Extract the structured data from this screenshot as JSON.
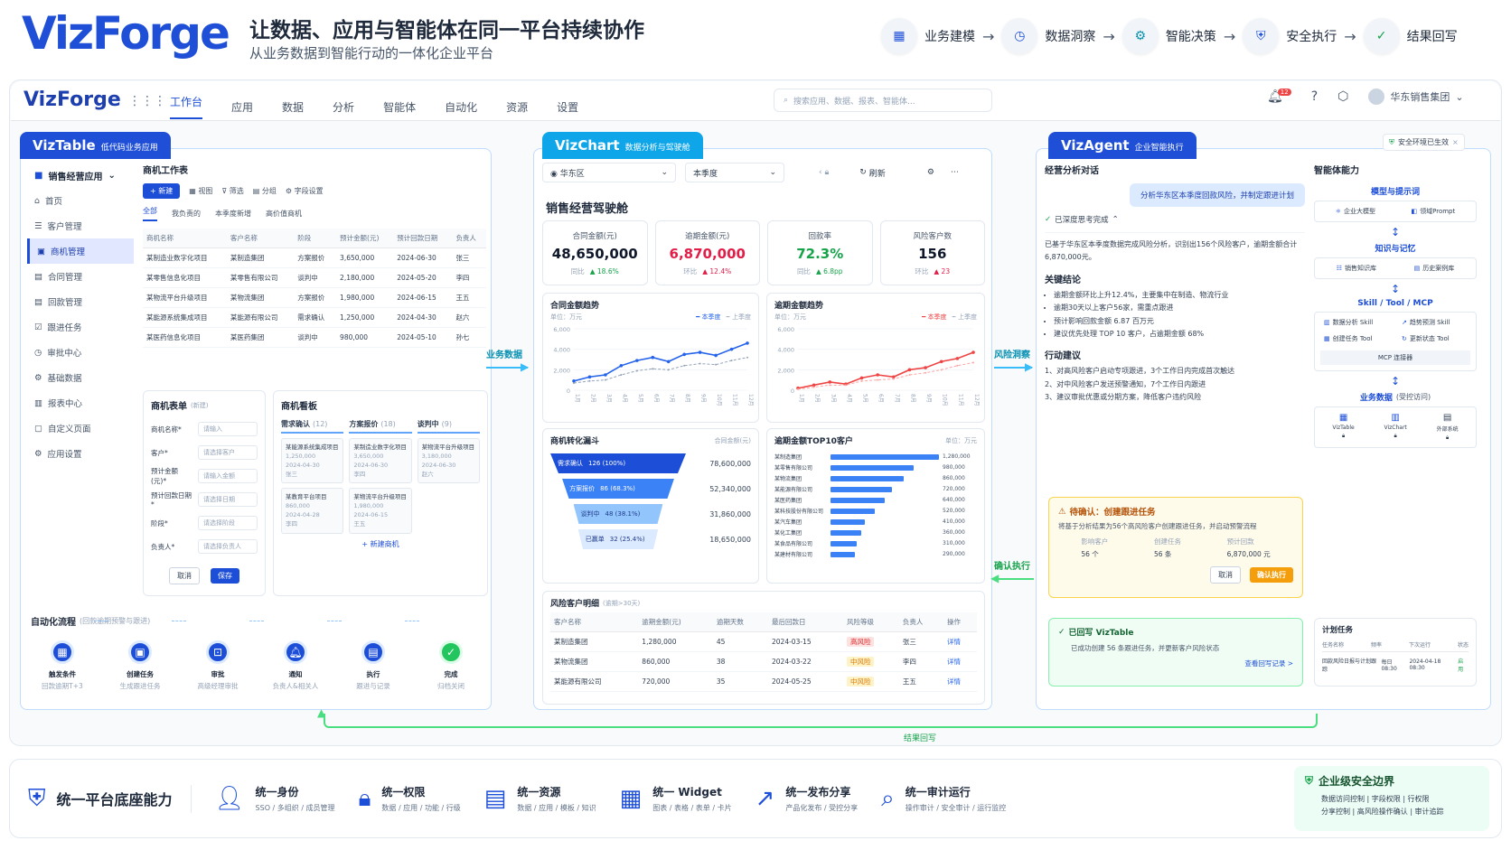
{
  "header": {
    "brand": "VizForge",
    "tagline": "让数据、应用与智能体在同一平台持续协作",
    "subline": "从业务数据到智能行动的一体化企业平台",
    "flow": [
      "业务建模",
      "数据洞察",
      "智能决策",
      "安全执行",
      "结果回写"
    ]
  },
  "nav": {
    "logo": "VizForge",
    "tabs": [
      "工作台",
      "应用",
      "数据",
      "分析",
      "智能体",
      "自动化",
      "资源",
      "设置"
    ],
    "search_placeholder": "搜索应用、数据、报表、智能体...",
    "notif_count": "12",
    "org": "华东销售集团"
  },
  "viztable": {
    "tab_title": "VizTable",
    "tab_sub": "低代码业务应用",
    "app_name": "销售经营应用",
    "side": [
      "首页",
      "客户管理",
      "商机管理",
      "合同管理",
      "回款管理",
      "跟进任务",
      "审批中心",
      "基础数据",
      "报表中心",
      "自定义页面",
      "应用设置"
    ],
    "work_title": "商机工作表",
    "toolbar": {
      "new": "+ 新建",
      "view": "视图",
      "filter": "筛选",
      "group": "分组",
      "field": "字段设置"
    },
    "subtabs": [
      "全部",
      "我负责的",
      "本季度新增",
      "高价值商机"
    ],
    "table_headers": [
      "商机名称",
      "客户名称",
      "阶段",
      "预计金额(元)",
      "预计回款日期",
      "负责人"
    ],
    "table_rows": [
      [
        "某制造业数字化项目",
        "某制造集团",
        "方案报价",
        "3,650,000",
        "2024-06-30",
        "张三"
      ],
      [
        "某零售信息化项目",
        "某零售有限公司",
        "谈判中",
        "2,180,000",
        "2024-05-20",
        "李四"
      ],
      [
        "某物流平台升级项目",
        "某物流集团",
        "方案报价",
        "1,980,000",
        "2024-06-15",
        "王五"
      ],
      [
        "某能源系统集成项目",
        "某能源有限公司",
        "需求确认",
        "1,250,000",
        "2024-04-30",
        "赵六"
      ],
      [
        "某医药信息化项目",
        "某医药集团",
        "谈判中",
        "980,000",
        "2024-05-10",
        "孙七"
      ]
    ],
    "form": {
      "title": "商机表单",
      "title_tag": "(新建)",
      "fields": [
        {
          "label": "商机名称*",
          "ph": "请输入"
        },
        {
          "label": "客户*",
          "ph": "请选择客户"
        },
        {
          "label": "预计金额(元)*",
          "ph": "请输入金额"
        },
        {
          "label": "预计回款日期*",
          "ph": "请选择日期"
        },
        {
          "label": "阶段*",
          "ph": "请选择阶段"
        },
        {
          "label": "负责人*",
          "ph": "请选择负责人"
        }
      ],
      "cancel": "取消",
      "save": "保存"
    },
    "kanban": {
      "title": "商机看板",
      "cols": [
        {
          "head": "需求确认",
          "count": "(12)",
          "cards": [
            {
              "l1": "某能源系统集成项目",
              "l2": "1,250,000",
              "l3": "2024-04-30",
              "l4": "张三"
            },
            {
              "l1": "某教育平台项目",
              "l2": "860,000",
              "l3": "2024-04-28",
              "l4": "李四"
            }
          ]
        },
        {
          "head": "方案报价",
          "count": "(18)",
          "cards": [
            {
              "l1": "某制造业数字化项目",
              "l2": "3,650,000",
              "l3": "2024-06-30",
              "l4": "李四"
            },
            {
              "l1": "某物流平台升级项目",
              "l2": "1,980,000",
              "l3": "2024-06-15",
              "l4": "王五"
            }
          ]
        },
        {
          "head": "谈判中",
          "count": "(9)",
          "cards": [
            {
              "l1": "某物流平台升级项目",
              "l2": "3,180,000",
              "l3": "2024-06-30",
              "l4": "赵六"
            }
          ]
        }
      ],
      "add": "+ 新建商机"
    },
    "auto": {
      "title": "自动化流程",
      "sub": "(回款逾期预警与跟进)",
      "steps": [
        {
          "t": "触发条件",
          "d": "回款逾期T+3"
        },
        {
          "t": "创建任务",
          "d": "生成跟进任务"
        },
        {
          "t": "审批",
          "d": "高级经理审批"
        },
        {
          "t": "通知",
          "d": "负责人&相关人"
        },
        {
          "t": "执行",
          "d": "跟进与记录"
        },
        {
          "t": "完成",
          "d": "归档关闭"
        }
      ]
    }
  },
  "vizchart": {
    "tab_title": "VizChart",
    "tab_sub": "数据分析与驾驶舱",
    "region": "华东区",
    "period": "本季度",
    "refresh": "刷新",
    "title": "销售经营驾驶舱",
    "kpis": [
      {
        "label": "合同金额(元)",
        "value": "48,650,000",
        "chg_lbl": "同比",
        "chg": "18.6%",
        "color": "#0f172a",
        "chg_color": "#16a34a"
      },
      {
        "label": "逾期金额(元)",
        "value": "6,870,000",
        "chg_lbl": "环比",
        "chg": "12.4%",
        "color": "#e11d48",
        "chg_color": "#e11d48"
      },
      {
        "label": "回款率",
        "value": "72.3%",
        "chg_lbl": "同比",
        "chg": "6.8pp",
        "color": "#16a34a",
        "chg_color": "#16a34a"
      },
      {
        "label": "风险客户数",
        "value": "156",
        "chg_lbl": "环比",
        "chg": "23",
        "color": "#0f172a",
        "chg_color": "#e11d48"
      }
    ],
    "trend1": {
      "title": "合同金额趋势",
      "unit": "单位：万元",
      "legend": [
        "本季度",
        "上季度"
      ]
    },
    "trend2": {
      "title": "逾期金额趋势",
      "unit": "单位：万元",
      "legend": [
        "本季度",
        "上季度"
      ]
    },
    "funnel": {
      "title": "商机转化漏斗",
      "unit": "合同金额(元)",
      "stages": [
        {
          "name": "需求确认",
          "cnt": "126 (100%)",
          "amount": "78,600,000",
          "color": "#1d4ed8",
          "frac": 1.0
        },
        {
          "name": "方案报价",
          "cnt": "86 (68.3%)",
          "amount": "52,340,000",
          "color": "#3b82f6",
          "frac": 0.683
        },
        {
          "name": "谈判中",
          "cnt": "48 (38.1%)",
          "amount": "31,860,000",
          "color": "#93c5fd",
          "frac": 0.381
        },
        {
          "name": "已赢单",
          "cnt": "32 (25.4%)",
          "amount": "18,650,000",
          "color": "#dbeafe",
          "frac": 0.254
        }
      ]
    },
    "top10": {
      "title": "逾期金额TOP10客户",
      "unit": "单位：万元",
      "names": [
        "某制造集团",
        "某零售有限公司",
        "某物流集团",
        "某能源有限公司",
        "某医药集团",
        "某科技股份有限公司",
        "某汽车集团",
        "某化工集团",
        "某食品有限公司",
        "某建材有限公司"
      ],
      "values": [
        "1,280,000",
        "980,000",
        "860,000",
        "720,000",
        "640,000",
        "520,000",
        "410,000",
        "360,000",
        "310,000",
        "290,000"
      ]
    },
    "risk": {
      "title": "风险客户明细",
      "sub": "(逾期>30天)",
      "headers": [
        "客户名称",
        "逾期金额(元)",
        "逾期天数",
        "最后回款日",
        "风险等级",
        "负责人",
        "操作"
      ],
      "rows": [
        [
          "某制造集团",
          "1,280,000",
          "45",
          "2024-03-15",
          "高风险",
          "张三",
          "详情"
        ],
        [
          "某物流集团",
          "860,000",
          "38",
          "2024-03-22",
          "中风险",
          "李四",
          "详情"
        ],
        [
          "某能源有限公司",
          "720,000",
          "35",
          "2024-05-25",
          "中风险",
          "王五",
          "详情"
        ]
      ]
    }
  },
  "chart_data": [
    {
      "type": "line",
      "title": "合同金额趋势",
      "ylabel": "单位：万元",
      "ylim": [
        0,
        6000
      ],
      "yticks": [
        "6,000",
        "4,000",
        "2,000",
        "0"
      ],
      "x": [
        "1月",
        "2月",
        "3月",
        "4月",
        "5月",
        "6月",
        "7月",
        "8月",
        "9月",
        "10月",
        "11月",
        "12月"
      ],
      "series": [
        {
          "name": "本季度",
          "color": "#2563eb",
          "values": [
            900,
            1300,
            1500,
            2400,
            2900,
            3200,
            2800,
            3500,
            3700,
            3400,
            4000,
            4600
          ]
        },
        {
          "name": "上季度",
          "color": "#94a3b8",
          "values": [
            700,
            900,
            1000,
            1500,
            1900,
            2100,
            2000,
            2400,
            2600,
            2500,
            2900,
            3200
          ]
        }
      ]
    },
    {
      "type": "line",
      "title": "逾期金额趋势",
      "ylabel": "单位：万元",
      "ylim": [
        0,
        6000
      ],
      "yticks": [
        "6,000",
        "4,000",
        "2,000",
        "0"
      ],
      "x": [
        "1月",
        "2月",
        "3月",
        "4月",
        "5月",
        "6月",
        "7月",
        "8月",
        "9月",
        "10月",
        "11月",
        "12月"
      ],
      "series": [
        {
          "name": "本季度",
          "color": "#ef4444",
          "values": [
            200,
            500,
            800,
            600,
            1200,
            1500,
            1300,
            2000,
            2200,
            2800,
            3100,
            3700
          ]
        },
        {
          "name": "上季度",
          "color": "#fca5a5",
          "values": [
            100,
            300,
            500,
            500,
            900,
            1000,
            1100,
            1500,
            1700,
            2000,
            2400,
            2700
          ]
        }
      ]
    },
    {
      "type": "bar",
      "title": "逾期金额TOP10客户",
      "categories": [
        "某制造集团",
        "某零售有限公司",
        "某物流集团",
        "某能源有限公司",
        "某医药集团",
        "某科技股份有限公司",
        "某汽车集团",
        "某化工集团",
        "某食品有限公司",
        "某建材有限公司"
      ],
      "values": [
        1280000,
        980000,
        860000,
        720000,
        640000,
        520000,
        410000,
        360000,
        310000,
        290000
      ]
    }
  ],
  "vizagent": {
    "tab_title": "VizAgent",
    "tab_sub": "企业智能执行",
    "safe": "安全环境已生效",
    "chat_title": "经营分析对话",
    "user_msg": "分析华东区本季度回款风险，并制定跟进计划",
    "thinking": "已深度思考完成",
    "summary": "已基于华东区本季度数据完成风险分析，识别出156个风险客户，逾期金额合计6,870,000元。",
    "concl_title": "关键结论",
    "conclusions": [
      "逾期金额环比上升12.4%，主要集中在制造、物流行业",
      "逾期30天以上客户56家，需重点跟进",
      "预计影响回款金额 6.87 百万元",
      "建议优先处理 TOP 10 客户，占逾期金额 68%"
    ],
    "action_title": "行动建议",
    "actions": [
      "1、对高风险客户启动专项跟进，3个工作日内完成首次触达",
      "2、对中风险客户发送预警通知，7个工作日内跟进",
      "3、建议审批优惠或分期方案，降低客户违约风险"
    ],
    "confirm": {
      "title": "待确认：创建跟进任务",
      "desc": "将基于分析结果为56个高风险客户创建跟进任务，并启动预警流程",
      "cols": [
        {
          "l": "影响客户",
          "v": "56 个"
        },
        {
          "l": "创建任务",
          "v": "56 条"
        },
        {
          "l": "预计回款",
          "v": "6,870,000 元"
        }
      ],
      "cancel": "取消",
      "ok": "确认执行"
    },
    "writeback": {
      "title": "已回写 VizTable",
      "desc": "已成功创建 56 条跟进任务，并更新客户风险状态",
      "link": "查看回写记录 >"
    },
    "cap_title": "智能体能力",
    "model": {
      "title": "模型与提示词",
      "items": [
        "企业大模型",
        "领域Prompt"
      ]
    },
    "memory": {
      "title": "知识与记忆",
      "items": [
        "销售知识库",
        "历史案例库"
      ]
    },
    "skill": {
      "title": "Skill / Tool / MCP",
      "items": [
        "数据分析 Skill",
        "趋势预测 Skill",
        "创建任务 Tool",
        "更新状态 Tool"
      ],
      "mcp": "MCP 连接器"
    },
    "bizdata": {
      "title": "业务数据",
      "sub": "(受控访问)",
      "items": [
        "VizTable",
        "VizChart",
        "外部系统"
      ]
    },
    "plan": {
      "title": "计划任务",
      "headers": [
        "任务名称",
        "频率",
        "下次运行",
        "状态"
      ],
      "row": [
        "回款风险日报与计划跟踪",
        "每日 08:30",
        "2024-04-18 08:30",
        "启用"
      ]
    }
  },
  "connectors": {
    "data": "业务数据",
    "insight": "风险洞察",
    "confirm": "确认执行",
    "result": "结果回写"
  },
  "bottom": {
    "title": "统一平台底座能力",
    "caps": [
      {
        "t": "统一身份",
        "d": "SSO / 多组织 / 成员管理"
      },
      {
        "t": "统一权限",
        "d": "数据 / 应用 / 功能 / 行级"
      },
      {
        "t": "统一资源",
        "d": "数据 / 应用 / 模板 / 知识"
      },
      {
        "t": "统一 Widget",
        "d": "图表 / 表格 / 表单 / 卡片"
      },
      {
        "t": "统一发布分享",
        "d": "产品化发布 / 受控分享"
      },
      {
        "t": "统一审计运行",
        "d": "操作审计 / 安全审计 / 运行监控"
      }
    ],
    "security": {
      "title": "企业级安全边界",
      "l1": "数据访问控制 | 字段权限 | 行权限",
      "l2": "分享控制 | 高风险操作确认 | 审计追踪"
    }
  }
}
